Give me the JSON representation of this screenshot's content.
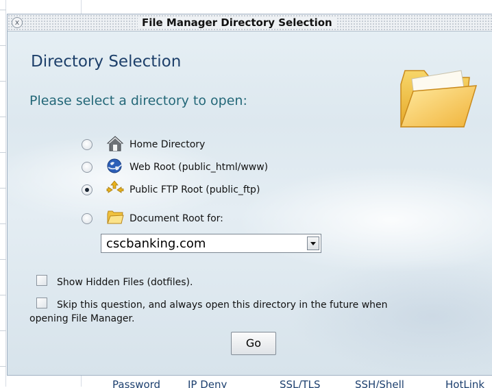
{
  "dialog": {
    "title": "File Manager Directory Selection",
    "close_label": "x",
    "heading": "Directory Selection",
    "prompt": "Please select a directory to open:",
    "options": [
      {
        "label": "Home Directory",
        "icon": "house-icon",
        "checked": false
      },
      {
        "label": "Web Root (public_html/www)",
        "icon": "globe-icon",
        "checked": false
      },
      {
        "label": "Public FTP Root (public_ftp)",
        "icon": "ftp-arrows-icon",
        "checked": true
      },
      {
        "label": "Document Root for:",
        "icon": "folder-icon",
        "checked": false
      }
    ],
    "domain_select": {
      "value": "cscbanking.com"
    },
    "checkboxes": {
      "show_hidden": {
        "label": "Show Hidden Files (dotfiles).",
        "checked": false
      },
      "skip_question": {
        "label_line1": "Skip this question, and always open this directory in the future when",
        "label_line2": "opening File Manager.",
        "checked": false
      }
    },
    "go_label": "Go"
  },
  "background_links": [
    "Password",
    "IP Deny",
    "SSL/TLS",
    "SSH/Shell",
    "HotLink"
  ],
  "colors": {
    "heading": "#1d3f6a",
    "prompt": "#236778",
    "link": "#1c3f6e"
  }
}
